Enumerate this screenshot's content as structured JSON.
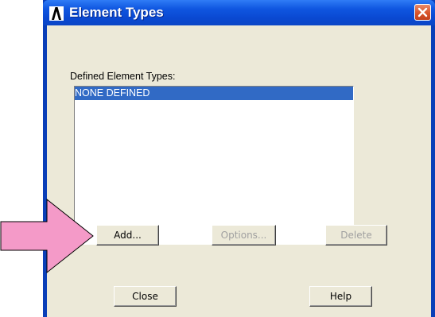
{
  "window": {
    "title": "Element Types"
  },
  "list": {
    "label": "Defined Element Types:",
    "items": [
      "NONE DEFINED"
    ]
  },
  "buttons": {
    "add": "Add...",
    "options": "Options...",
    "delete": "Delete",
    "close": "Close",
    "help": "Help"
  },
  "colors": {
    "titlebar": "#0a49d2",
    "selection": "#316ac5",
    "dialog_bg": "#ece9d8",
    "arrow": "#f49ac8"
  }
}
